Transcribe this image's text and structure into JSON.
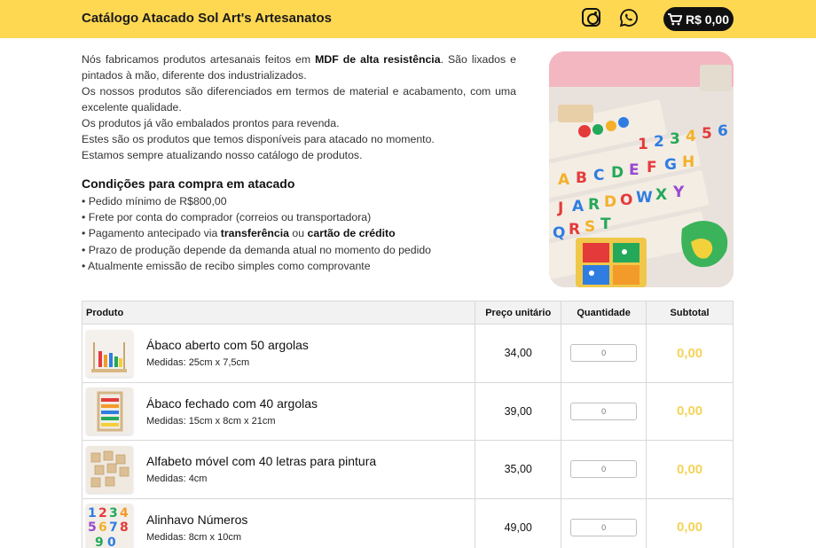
{
  "header": {
    "title": "Catálogo Atacado Sol Art's Artesanatos",
    "instagram_icon": "instagram-icon",
    "whatsapp_icon": "whatsapp-icon",
    "cart_icon": "cart-icon",
    "cart_total": "R$ 0,00",
    "accent_color": "#ffd852"
  },
  "intro": {
    "p1_a": "Nós fabricamos produtos artesanais feitos em ",
    "p1_bold": "MDF de alta resistência",
    "p1_b": ". São lixados e pintados à mão, diferente dos industrializados.",
    "p2": "Os nossos produtos são diferenciados em termos de material e acabamento, com uma excelente qualidade.",
    "p3": "Os produtos já vão embalados prontos para revenda.",
    "p4": "Estes são os produtos que temos disponíveis para atacado no momento.",
    "p5": "Estamos sempre atualizando nosso catálogo de produtos."
  },
  "conditions": {
    "title": "Condições para compra em atacado",
    "items": [
      "Pedido mínimo de R$800,00",
      "Frete por conta do comprador (correios ou transportadora)",
      "Prazo de produção depende da demanda atual no momento do pedido",
      "Atualmente emissão de recibo simples como comprovante"
    ],
    "payment_a": "Pagamento antecipado via ",
    "payment_b1": "transferência",
    "payment_or": " ou ",
    "payment_b2": "cartão de crédito"
  },
  "table": {
    "headers": {
      "product": "Produto",
      "price": "Preço unitário",
      "quantity": "Quantidade",
      "subtotal": "Subtotal"
    },
    "rows": [
      {
        "name": "Ábaco aberto com 50 argolas",
        "dims": "Medidas: 25cm x 7,5cm",
        "price": "34,00",
        "qty_placeholder": "0",
        "subtotal": "0,00"
      },
      {
        "name": "Ábaco fechado com 40 argolas",
        "dims": "Medidas: 15cm x 8cm x 21cm",
        "price": "39,00",
        "qty_placeholder": "0",
        "subtotal": "0,00"
      },
      {
        "name": "Alfabeto móvel com 40 letras para pintura",
        "dims": "Medidas: 4cm",
        "price": "35,00",
        "qty_placeholder": "0",
        "subtotal": "0,00"
      },
      {
        "name": "Alinhavo Números",
        "dims": "Medidas: 8cm x 10cm",
        "price": "49,00",
        "qty_placeholder": "0",
        "subtotal": "0,00"
      }
    ],
    "subtotal_color": "#f5d35a"
  }
}
